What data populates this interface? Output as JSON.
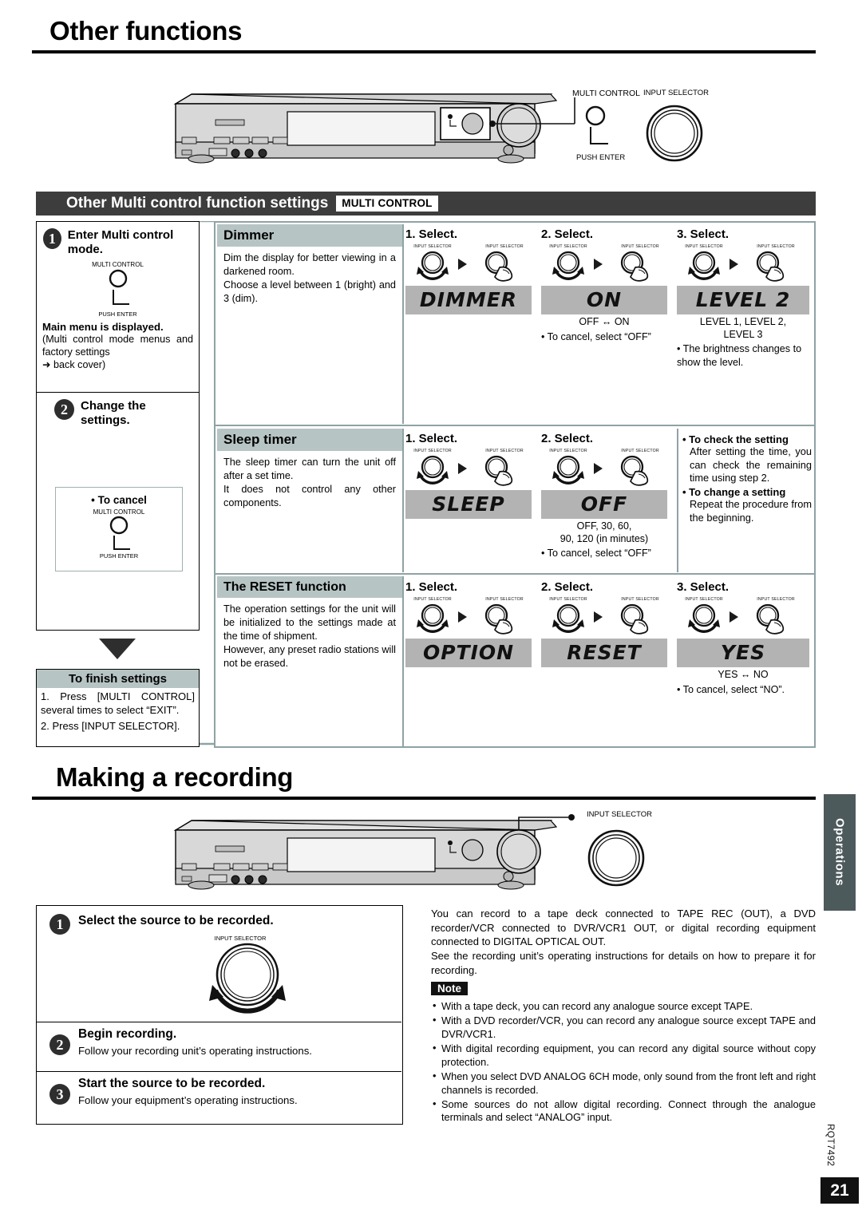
{
  "page": {
    "title_other_functions": "Other functions",
    "title_making_recording": "Making a recording",
    "side_tab": "Operations",
    "doc_code": "RQT7492",
    "page_number": "21"
  },
  "device_top": {
    "callout_multi_control": "MULTI CONTROL",
    "callout_push_enter": "PUSH ENTER",
    "callout_input_selector": "INPUT SELECTOR"
  },
  "section": {
    "heading": "Other Multi control function settings",
    "tag": "MULTI CONTROL"
  },
  "steps_left": {
    "step1_num": "1",
    "step1_text": "Enter Multi control mode.",
    "step1_knob_cap": "MULTI CONTROL",
    "step1_knob_sub": "PUSH ENTER",
    "step1_result_bold": "Main menu is displayed",
    "step1_result_rest": ".",
    "step1_paren": "(Multi control mode menus and factory settings",
    "step1_arrow": "➜ back cover)",
    "step2_num": "2",
    "step2_text": "Change the settings.",
    "cancel_label": "• To cancel",
    "cancel_knob_cap": "MULTI CONTROL",
    "cancel_knob_sub": "PUSH ENTER",
    "finish_head": "To finish settings",
    "finish_items": [
      "1. Press [MULTI CONTROL] several times to select “EXIT”.",
      "2. Press [INPUT SELECTOR]."
    ]
  },
  "rows": [
    {
      "title": "Dimmer",
      "desc": "Dim the display for better viewing in a darkened room.\nChoose a level between 1 (bright) and 3 (dim).",
      "steps": [
        {
          "label": "1. Select.",
          "knob_cap": "INPUT SELECTOR",
          "lcd": "DIMMER",
          "captions": [],
          "bullets": []
        },
        {
          "label": "2. Select.",
          "knob_cap": "INPUT SELECTOR",
          "lcd": "ON",
          "captions": [
            "OFF ↔ ON"
          ],
          "bullets": [
            "• To cancel, select “OFF”"
          ]
        },
        {
          "label": "3. Select.",
          "knob_cap": "INPUT SELECTOR",
          "lcd": "LEVEL 2",
          "captions": [
            "LEVEL 1, LEVEL 2,",
            "LEVEL 3"
          ],
          "bullets": [
            "• The brightness changes to show the level."
          ]
        }
      ]
    },
    {
      "title": "Sleep timer",
      "desc": "The sleep timer can turn the unit off after a set time.\nIt does not control any other components.",
      "steps": [
        {
          "label": "1. Select.",
          "knob_cap": "INPUT SELECTOR",
          "lcd": "SLEEP",
          "captions": [],
          "bullets": []
        },
        {
          "label": "2. Select.",
          "knob_cap": "INPUT SELECTOR",
          "lcd": "OFF",
          "captions": [
            "OFF, 30, 60,",
            "90, 120 (in minutes)"
          ],
          "bullets": [
            "• To cancel, select “OFF”"
          ]
        }
      ],
      "side_notes": [
        {
          "bold": "• To check the setting",
          "text": "After setting the time, you can check the remaining time using step 2."
        },
        {
          "bold": "• To change a setting",
          "text": "Repeat the procedure from the beginning."
        }
      ]
    },
    {
      "title": "The RESET function",
      "desc": "The operation settings for the unit will be initialized to the settings made at the time of shipment.\nHowever, any preset radio stations will not be erased.",
      "steps": [
        {
          "label": "1. Select.",
          "knob_cap": "INPUT SELECTOR",
          "lcd": "OPTION",
          "captions": [],
          "bullets": []
        },
        {
          "label": "2. Select.",
          "knob_cap": "INPUT SELECTOR",
          "lcd": "RESET",
          "captions": [],
          "bullets": []
        },
        {
          "label": "3. Select.",
          "knob_cap": "INPUT SELECTOR",
          "lcd": "YES",
          "captions": [
            "YES ↔ NO"
          ],
          "bullets": [
            "• To cancel, select “NO”."
          ]
        }
      ]
    }
  ],
  "recording": {
    "callout_input_selector": "INPUT SELECTOR",
    "steps": [
      {
        "num": "1",
        "title": "Select the source to be recorded.",
        "sub": "",
        "knob_cap": "INPUT SELECTOR"
      },
      {
        "num": "2",
        "title": "Begin recording.",
        "sub": "Follow your recording unit’s operating instructions."
      },
      {
        "num": "3",
        "title": "Start the source to be recorded.",
        "sub": "Follow your equipment’s operating instructions."
      }
    ],
    "intro_p1": "You can record to a tape deck connected to TAPE REC (OUT), a DVD recorder/VCR connected to DVR/VCR1 OUT, or digital recording equipment connected to DIGITAL OPTICAL OUT.",
    "intro_p2": "See the recording unit’s operating instructions for details on how to prepare it for recording.",
    "note_label": "Note",
    "notes": [
      "With a tape deck, you can record any analogue source except TAPE.",
      "With a DVD recorder/VCR, you can record any analogue source except TAPE and DVR/VCR1.",
      "With digital recording equipment, you can record any digital source without copy protection.",
      "When you select DVD ANALOG 6CH mode, only sound from the front left and right channels is recorded.",
      "Some sources do not allow digital recording. Connect through the analogue terminals and select “ANALOG” input."
    ]
  }
}
